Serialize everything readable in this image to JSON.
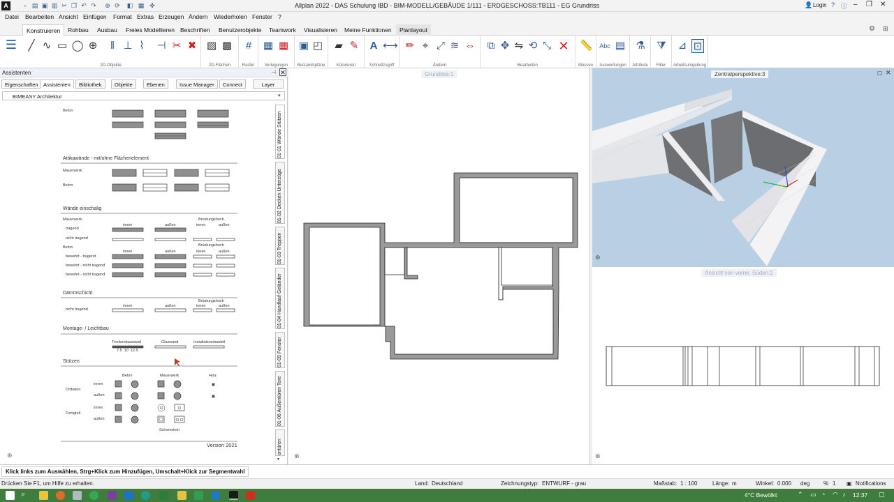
{
  "titlebar": {
    "app_letter": "A",
    "title": "Allplan 2022 - DAS Schulung IBD - BIM-MODELL/GEBÄUDE 1/111 - ERDGESCHOSS:TB111 - EG Grundriss",
    "login": "Login"
  },
  "menu": [
    "Datei",
    "Bearbeiten",
    "Ansicht",
    "Einfügen",
    "Format",
    "Extras",
    "Erzeugen",
    "Ändern",
    "Wiederholen",
    "Fenster",
    "?"
  ],
  "ribbon_tabs": [
    "Konstruieren",
    "Rohbau",
    "Ausbau",
    "Freies Modellieren",
    "Beschriften",
    "Benutzerobjekte",
    "Teamwork",
    "Visualisieren",
    "Meine Funktionen",
    "Planlayout"
  ],
  "ribbon_groups": [
    "2D-Objekte",
    "2D-Flächen",
    "Raster",
    "Verlegungen",
    "Bestandspläne",
    "Kolorieren",
    "Schnellzugriff",
    "Ändern",
    "Bearbeiten",
    "Messen",
    "Auswertungen",
    "Attribute",
    "Filter",
    "Arbeitsumgebung"
  ],
  "assistant": {
    "title": "Assistenten",
    "tabs": [
      "Eigenschaften",
      "Assistenten",
      "Bibliothek",
      "Objekte",
      "Ebenen",
      "Issue Manager",
      "Connect",
      "Layer"
    ],
    "combo_value": "BIMEASY Architektur",
    "vertical_tabs": [
      "01-01 Wände Stützen",
      "01-02 Decken Unterzüge",
      "01-03 Treppen",
      "01-04 Handlauf Geländer",
      "01-05 Fenster",
      "01-06 Außentüren Tore",
      "01-07 Innentüren"
    ],
    "vertical_tab_visible_texts": [
      "01-01 Wände Stützen",
      "01-02 Decken Unterzüge",
      "01-03 Treppen",
      "01-04 Handlauf Geländer",
      "01-05 Fenster",
      "01-06 Außentüren Tore",
      "ontüren"
    ],
    "library": {
      "beton_top": "Beton",
      "attika_heading": "Attikawände - mit/ohne Flächenelement",
      "attika_mauerwerk": "Mauerwerk",
      "attika_beton": "Beton",
      "waende_heading": "Wände einschalig",
      "w_mauerwerk": "Mauerwerk",
      "w_innen": "innen",
      "w_aussen": "außen",
      "w_bruest": "Brüstungshoch",
      "w_tragend": "tragend",
      "w_nichttragend": "nicht tragend",
      "w_beton": "Beton",
      "w_bew_tragend": "bewehrt - tragend",
      "w_bew_nicht1": "bewehrt - nicht tragend",
      "w_bew_nicht2": "bewehrt - nicht tragend",
      "daemm_heading": "Dämmschicht",
      "d_nichttragend": "nicht tragend",
      "montage_heading": "Montage- / Leichtbau",
      "m_trocken": "Trockenbauwand",
      "m_glas": "Glaswand",
      "m_install": "Installationsbauteil",
      "m_sizes": "7.5  10  12.5",
      "stuetzen_heading": "Stützen",
      "s_beton": "Beton",
      "s_mauerwerk": "Mauerwerk",
      "s_holz": "Holz",
      "s_ortbeton": "Ortbeton",
      "s_fertigteil": "Fertigteil",
      "s_innen": "innen",
      "s_aussen": "außen",
      "s_schornstein": "Schornstein",
      "version": "Version 2021"
    }
  },
  "viewports": {
    "plan": "Grundriss:1",
    "perspective": "Zentralperspektive:3",
    "elevation": "Ansicht von vorne, Süden:2"
  },
  "status": {
    "hint": "Klick links zum Auswählen, Strg+Klick zum Hinzufügen, Umschalt+Klick zur Segmentwahl",
    "help": "Drücken Sie F1, um Hilfe zu erhalten.",
    "land_label": "Land:",
    "land": "Deutschland",
    "zeich_label": "Zeichnungstyp:",
    "zeich": "ENTWURF - grau",
    "mass_label": "Maßstab:",
    "mass": "1 : 100",
    "laenge_label": "Länge:",
    "laenge": "m",
    "winkel_label": "Winkel:",
    "winkel": "0.000",
    "winkel_unit": "deg",
    "percent_label": "%",
    "percent": "1",
    "notifications": "Notifications"
  },
  "taskbar": {
    "weather": "4°C  Bewölkt",
    "time": "12:37"
  },
  "colors": {
    "accent": "#2d5d8f",
    "taskbar": "#3f7d3f",
    "wall_fill": "#9a9a9a",
    "sky": "#b9cfe3"
  }
}
